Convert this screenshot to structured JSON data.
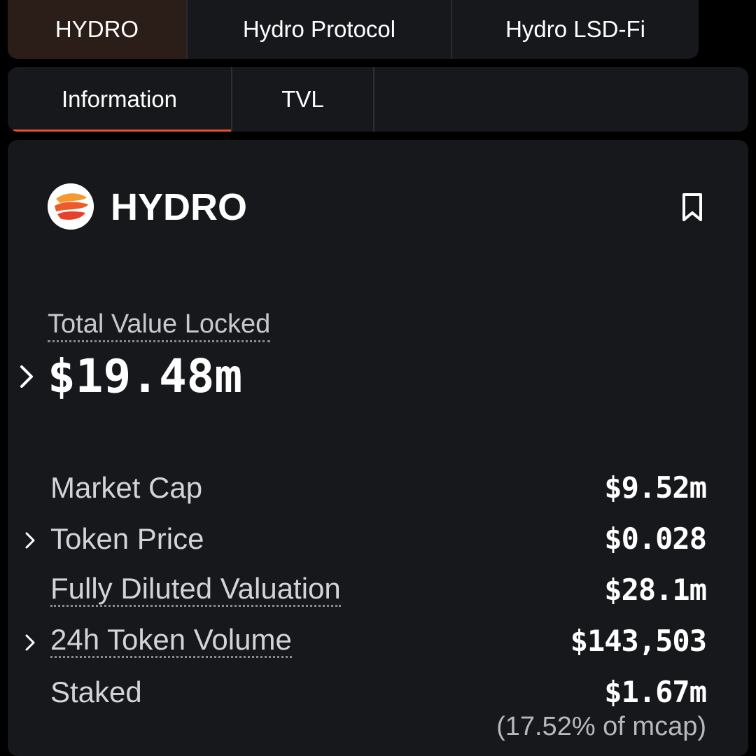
{
  "protocol_tabs": [
    {
      "label": "HYDRO",
      "active": true
    },
    {
      "label": "Hydro Protocol",
      "active": false
    },
    {
      "label": "Hydro LSD-Fi",
      "active": false
    }
  ],
  "section_tabs": [
    {
      "label": "Information",
      "active": true
    },
    {
      "label": "TVL",
      "active": false
    }
  ],
  "header": {
    "name": "HYDRO",
    "logo_icon": "hydro-logo-icon",
    "bookmark_icon": "bookmark-icon"
  },
  "tvl": {
    "label": "Total Value Locked",
    "value": "$19.48m"
  },
  "metrics": [
    {
      "label": "Market Cap",
      "value": "$9.52m"
    },
    {
      "label": "Token Price",
      "value": "$0.028"
    },
    {
      "label": "Fully Diluted Valuation",
      "value": "$28.1m"
    },
    {
      "label": "24h Token Volume",
      "value": "$143,503"
    },
    {
      "label": "Staked",
      "value": "$1.67m",
      "sub": "(17.52% of mcap)"
    }
  ],
  "colors": {
    "accent": "#e8502f",
    "background": "#000000",
    "panel": "#17181b",
    "active_tab": "#2b1d18"
  }
}
